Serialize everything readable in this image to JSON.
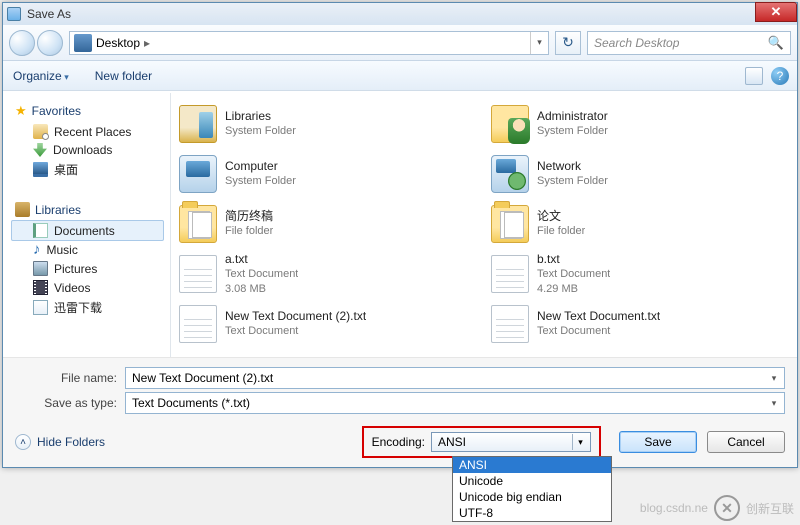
{
  "title": "Save As",
  "nav": {
    "location": "Desktop",
    "sep": "▸",
    "search_placeholder": "Search Desktop"
  },
  "toolbar": {
    "organize": "Organize",
    "new_folder": "New folder"
  },
  "sidebar": {
    "favorites_label": "Favorites",
    "favorites": [
      {
        "label": "Recent Places",
        "icon": "recent"
      },
      {
        "label": "Downloads",
        "icon": "dl"
      },
      {
        "label": "桌面",
        "icon": "desk"
      }
    ],
    "libraries_label": "Libraries",
    "libraries": [
      {
        "label": "Documents",
        "icon": "doc"
      },
      {
        "label": "Music",
        "icon": "music"
      },
      {
        "label": "Pictures",
        "icon": "pic"
      },
      {
        "label": "Videos",
        "icon": "vid"
      },
      {
        "label": "迅雷下载",
        "icon": "xl"
      }
    ]
  },
  "files": [
    {
      "name": "Libraries",
      "sub1": "System Folder",
      "sub2": "",
      "icon": "lib"
    },
    {
      "name": "Administrator",
      "sub1": "System Folder",
      "sub2": "",
      "icon": "user"
    },
    {
      "name": "Computer",
      "sub1": "System Folder",
      "sub2": "",
      "icon": "comp"
    },
    {
      "name": "Network",
      "sub1": "System Folder",
      "sub2": "",
      "icon": "net"
    },
    {
      "name": "简历终稿",
      "sub1": "File folder",
      "sub2": "",
      "icon": "folderpaper"
    },
    {
      "name": "论文",
      "sub1": "File folder",
      "sub2": "",
      "icon": "folderpaper"
    },
    {
      "name": "a.txt",
      "sub1": "Text Document",
      "sub2": "3.08 MB",
      "icon": "txt"
    },
    {
      "name": "b.txt",
      "sub1": "Text Document",
      "sub2": "4.29 MB",
      "icon": "txt"
    },
    {
      "name": "New Text Document (2).txt",
      "sub1": "Text Document",
      "sub2": "",
      "icon": "txt"
    },
    {
      "name": "New Text Document.txt",
      "sub1": "Text Document",
      "sub2": "",
      "icon": "txt"
    }
  ],
  "form": {
    "file_name_label": "File name:",
    "file_name_value": "New Text Document (2).txt",
    "save_type_label": "Save as type:",
    "save_type_value": "Text Documents (*.txt)",
    "hide_folders": "Hide Folders",
    "encoding_label": "Encoding:",
    "encoding_value": "ANSI",
    "encoding_options": [
      "ANSI",
      "Unicode",
      "Unicode big endian",
      "UTF-8"
    ],
    "save": "Save",
    "cancel": "Cancel"
  },
  "watermark": {
    "url": "blog.csdn.ne",
    "brand": "创新互联"
  }
}
